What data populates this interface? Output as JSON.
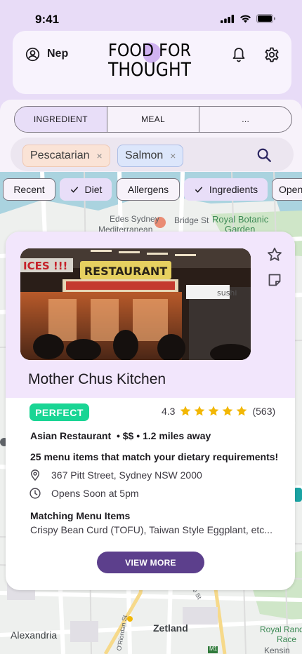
{
  "status_bar": {
    "time": "9:41"
  },
  "header": {
    "user_name": "Nep",
    "logo_line1": "FOOD FOR",
    "logo_line2": "THOUGHT"
  },
  "mode_tabs": [
    {
      "label": "INGREDIENT",
      "active": true
    },
    {
      "label": "MEAL",
      "active": false
    },
    {
      "label": "...",
      "active": false
    }
  ],
  "search": {
    "tags": [
      "Pescatarian",
      "Salmon"
    ],
    "remove_glyph": "×"
  },
  "filter_chips": [
    {
      "label": "Recent",
      "selected": false
    },
    {
      "label": "Diet",
      "selected": true
    },
    {
      "label": "Allergens",
      "selected": false
    },
    {
      "label": "Ingredients",
      "selected": true
    },
    {
      "label": "Open",
      "selected": false
    }
  ],
  "map_labels": {
    "edes": "Edes Sydney",
    "mediterranean": "Mediterranean",
    "bridge_st": "Bridge St",
    "royal_botanic": "Royal Botanic",
    "garden": "Garden",
    "zetland": "Zetland",
    "alexandria": "Alexandria",
    "royal_randwick": "Royal Rand",
    "racecourse": "Race",
    "kensington": "Kensin",
    "bourke_st": "Bourke St",
    "riordan": "O'Riordan St",
    "m1": "M1"
  },
  "result": {
    "photo_sign": "RESTAURANT",
    "photo_sign2": "ICES !!!",
    "photo_sign3": "sushi",
    "name": "Mother Chus Kitchen",
    "badge": "PERFECT",
    "rating": "4.3",
    "rating_value": 4.3,
    "review_count": "(563)",
    "category": "Asian Restaurant",
    "price_distance": "• $$ • 1.2 miles away",
    "match_text": "25 menu items that match your dietary requirements!",
    "address": "367 Pitt Street, Sydney NSW 2000",
    "hours": "Opens Soon at 5pm",
    "menu_title": "Matching Menu Items",
    "menu_items": "Crispy Bean Curd (TOFU), Taiwan Style Eggplant, etc...",
    "cta": "VIEW MORE"
  },
  "colors": {
    "accent": "#5c3f8c",
    "badge_green": "#19d594",
    "star_gold": "#f2b705",
    "header_bg": "#e8dcf7"
  }
}
